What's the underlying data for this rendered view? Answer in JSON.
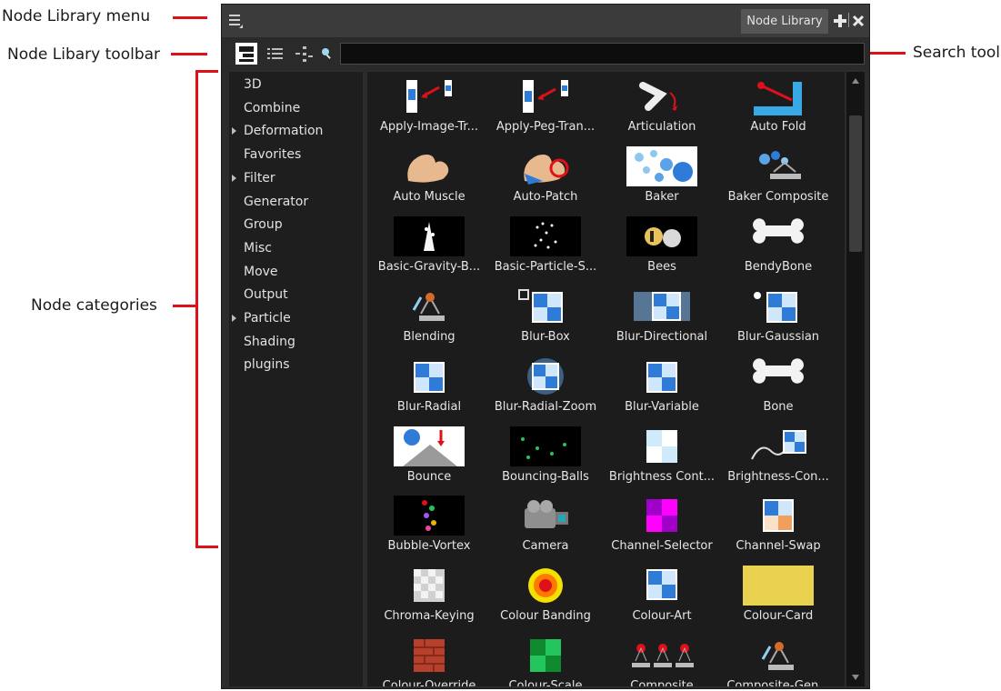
{
  "callouts": {
    "menu": "Node Library menu",
    "toolbar": "Node Libary toolbar",
    "categories": "Node categories",
    "search": "Search tool"
  },
  "tab": {
    "label": "Node Library"
  },
  "search": {
    "value": "",
    "placeholder": ""
  },
  "categories": [
    {
      "label": "3D",
      "expandable": false
    },
    {
      "label": "Combine",
      "expandable": false
    },
    {
      "label": "Deformation",
      "expandable": true
    },
    {
      "label": "Favorites",
      "expandable": false
    },
    {
      "label": "Filter",
      "expandable": true
    },
    {
      "label": "Generator",
      "expandable": false
    },
    {
      "label": "Group",
      "expandable": false
    },
    {
      "label": "Misc",
      "expandable": false
    },
    {
      "label": "Move",
      "expandable": false
    },
    {
      "label": "Output",
      "expandable": false
    },
    {
      "label": "Particle",
      "expandable": true
    },
    {
      "label": "Shading",
      "expandable": false
    },
    {
      "label": "plugins",
      "expandable": false
    }
  ],
  "nodes": [
    {
      "label": "Apply-Image-Tr...",
      "icon": "apply-image-transformation-icon"
    },
    {
      "label": "Apply-Peg-Tran...",
      "icon": "apply-peg-transformation-icon"
    },
    {
      "label": "Articulation",
      "icon": "articulation-icon"
    },
    {
      "label": "Auto Fold",
      "icon": "auto-fold-icon"
    },
    {
      "label": "Auto Muscle",
      "icon": "auto-muscle-icon"
    },
    {
      "label": "Auto-Patch",
      "icon": "auto-patch-icon"
    },
    {
      "label": "Baker",
      "icon": "baker-icon"
    },
    {
      "label": "Baker Composite",
      "icon": "baker-composite-icon"
    },
    {
      "label": "Basic-Gravity-B...",
      "icon": "basic-gravity-icon"
    },
    {
      "label": "Basic-Particle-S...",
      "icon": "basic-particle-icon"
    },
    {
      "label": "Bees",
      "icon": "bees-icon"
    },
    {
      "label": "BendyBone",
      "icon": "bendybone-icon"
    },
    {
      "label": "Blending",
      "icon": "blending-icon"
    },
    {
      "label": "Blur-Box",
      "icon": "blur-box-icon"
    },
    {
      "label": "Blur-Directional",
      "icon": "blur-directional-icon"
    },
    {
      "label": "Blur-Gaussian",
      "icon": "blur-gaussian-icon"
    },
    {
      "label": "Blur-Radial",
      "icon": "blur-radial-icon"
    },
    {
      "label": "Blur-Radial-Zoom",
      "icon": "blur-radial-zoom-icon"
    },
    {
      "label": "Blur-Variable",
      "icon": "blur-variable-icon"
    },
    {
      "label": "Bone",
      "icon": "bone-icon"
    },
    {
      "label": "Bounce",
      "icon": "bounce-icon"
    },
    {
      "label": "Bouncing-Balls",
      "icon": "bouncing-balls-icon"
    },
    {
      "label": "Brightness Cont...",
      "icon": "brightness-contrast-icon"
    },
    {
      "label": "Brightness-Con...",
      "icon": "brightness-contrast-curve-icon"
    },
    {
      "label": "Bubble-Vortex",
      "icon": "bubble-vortex-icon"
    },
    {
      "label": "Camera",
      "icon": "camera-icon"
    },
    {
      "label": "Channel-Selector",
      "icon": "channel-selector-icon"
    },
    {
      "label": "Channel-Swap",
      "icon": "channel-swap-icon"
    },
    {
      "label": "Chroma-Keying",
      "icon": "chroma-keying-icon"
    },
    {
      "label": "Colour Banding",
      "icon": "colour-banding-icon"
    },
    {
      "label": "Colour-Art",
      "icon": "colour-art-icon"
    },
    {
      "label": "Colour-Card",
      "icon": "colour-card-icon"
    },
    {
      "label": "Colour-Override",
      "icon": "colour-override-icon"
    },
    {
      "label": "Colour-Scale",
      "icon": "colour-scale-icon"
    },
    {
      "label": "Composite",
      "icon": "composite-icon"
    },
    {
      "label": "Composite-Gen...",
      "icon": "composite-generic-icon"
    }
  ],
  "colors": {
    "accent_red": "#e0101a",
    "panel_bg": "#2c2c2c",
    "list_bg": "#1c1c1c"
  }
}
